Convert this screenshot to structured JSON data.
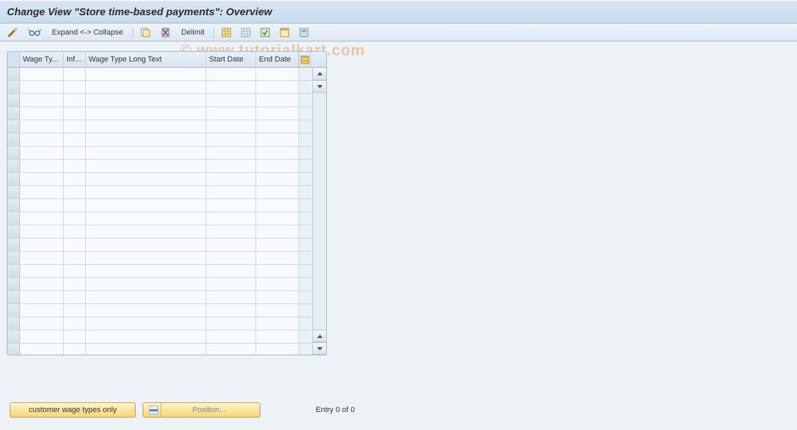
{
  "title": "Change View \"Store time-based payments\": Overview",
  "toolbar": {
    "expand_collapse_label": "Expand <-> Collapse",
    "delimit_label": "Delimit"
  },
  "watermark": "© www.tutorialkart.com",
  "table": {
    "columns": {
      "c1": "Wage Ty...",
      "c2": "Inf...",
      "c3": "Wage Type Long Text",
      "c4": "Start Date",
      "c5": "End Date"
    },
    "row_count": 22
  },
  "footer": {
    "customer_button": "customer wage types only",
    "position_button": "Position...",
    "entry_text": "Entry 0 of 0"
  }
}
